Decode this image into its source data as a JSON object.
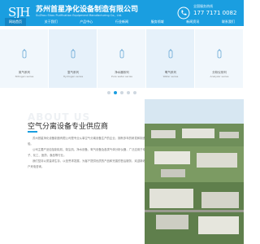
{
  "header": {
    "logo_text": "SJH",
    "company_name": "苏州首星净化设备制造有限公司",
    "company_name_en": "SuZhou Shou Purification Equipment Manufacturing Co., Ltd.",
    "hotline_label": "全国服务热线",
    "hotline_number": "177 7171 0082"
  },
  "nav": {
    "items": [
      "网站首页",
      "关于我们",
      "产品中心",
      "行业新闻",
      "服务领域",
      "新闻资讯",
      "联系我们"
    ],
    "active_index": 0
  },
  "products": [
    {
      "name": "氮气系列",
      "name_en": "Nitrogen series",
      "icon": "gas-cylinder-icon"
    },
    {
      "name": "氢气系列",
      "name_en": "Hydrogen series",
      "icon": "gas-cylinder-icon"
    },
    {
      "name": "净水器系列",
      "name_en": "Pure water series",
      "icon": "gas-cylinder-icon"
    },
    {
      "name": "氧气系列",
      "name_en": "Water series",
      "icon": "gas-cylinder-icon"
    },
    {
      "name": "分析仪系列",
      "name_en": "Analyzer series",
      "icon": "gas-cylinder-icon"
    }
  ],
  "carousel": {
    "count": 5,
    "active_index": 1
  },
  "about": {
    "bg_text": "ABOUT US",
    "title": "空气分离设备专业供应商",
    "paragraphs": [
      "苏州首星净化设备制造有限公司是专业从事空气分离设备生产的企业，拥有多年的研发和制造经验。",
      "公司主要产品包括制氮机、制氢机、净水设备、氧气设备及各类气体分析仪器，广泛应用于电子、化工、医药、食品等行业。",
      "我们坚持以质量求生存、以信誉求发展，为客户提供优质的产品和完善的售后服务，欢迎新老客户来电咨询。"
    ]
  },
  "colors": {
    "brand": "#1a9ee0",
    "nav_active": "#1485c4",
    "strip_bg": "#f1f7fc"
  }
}
